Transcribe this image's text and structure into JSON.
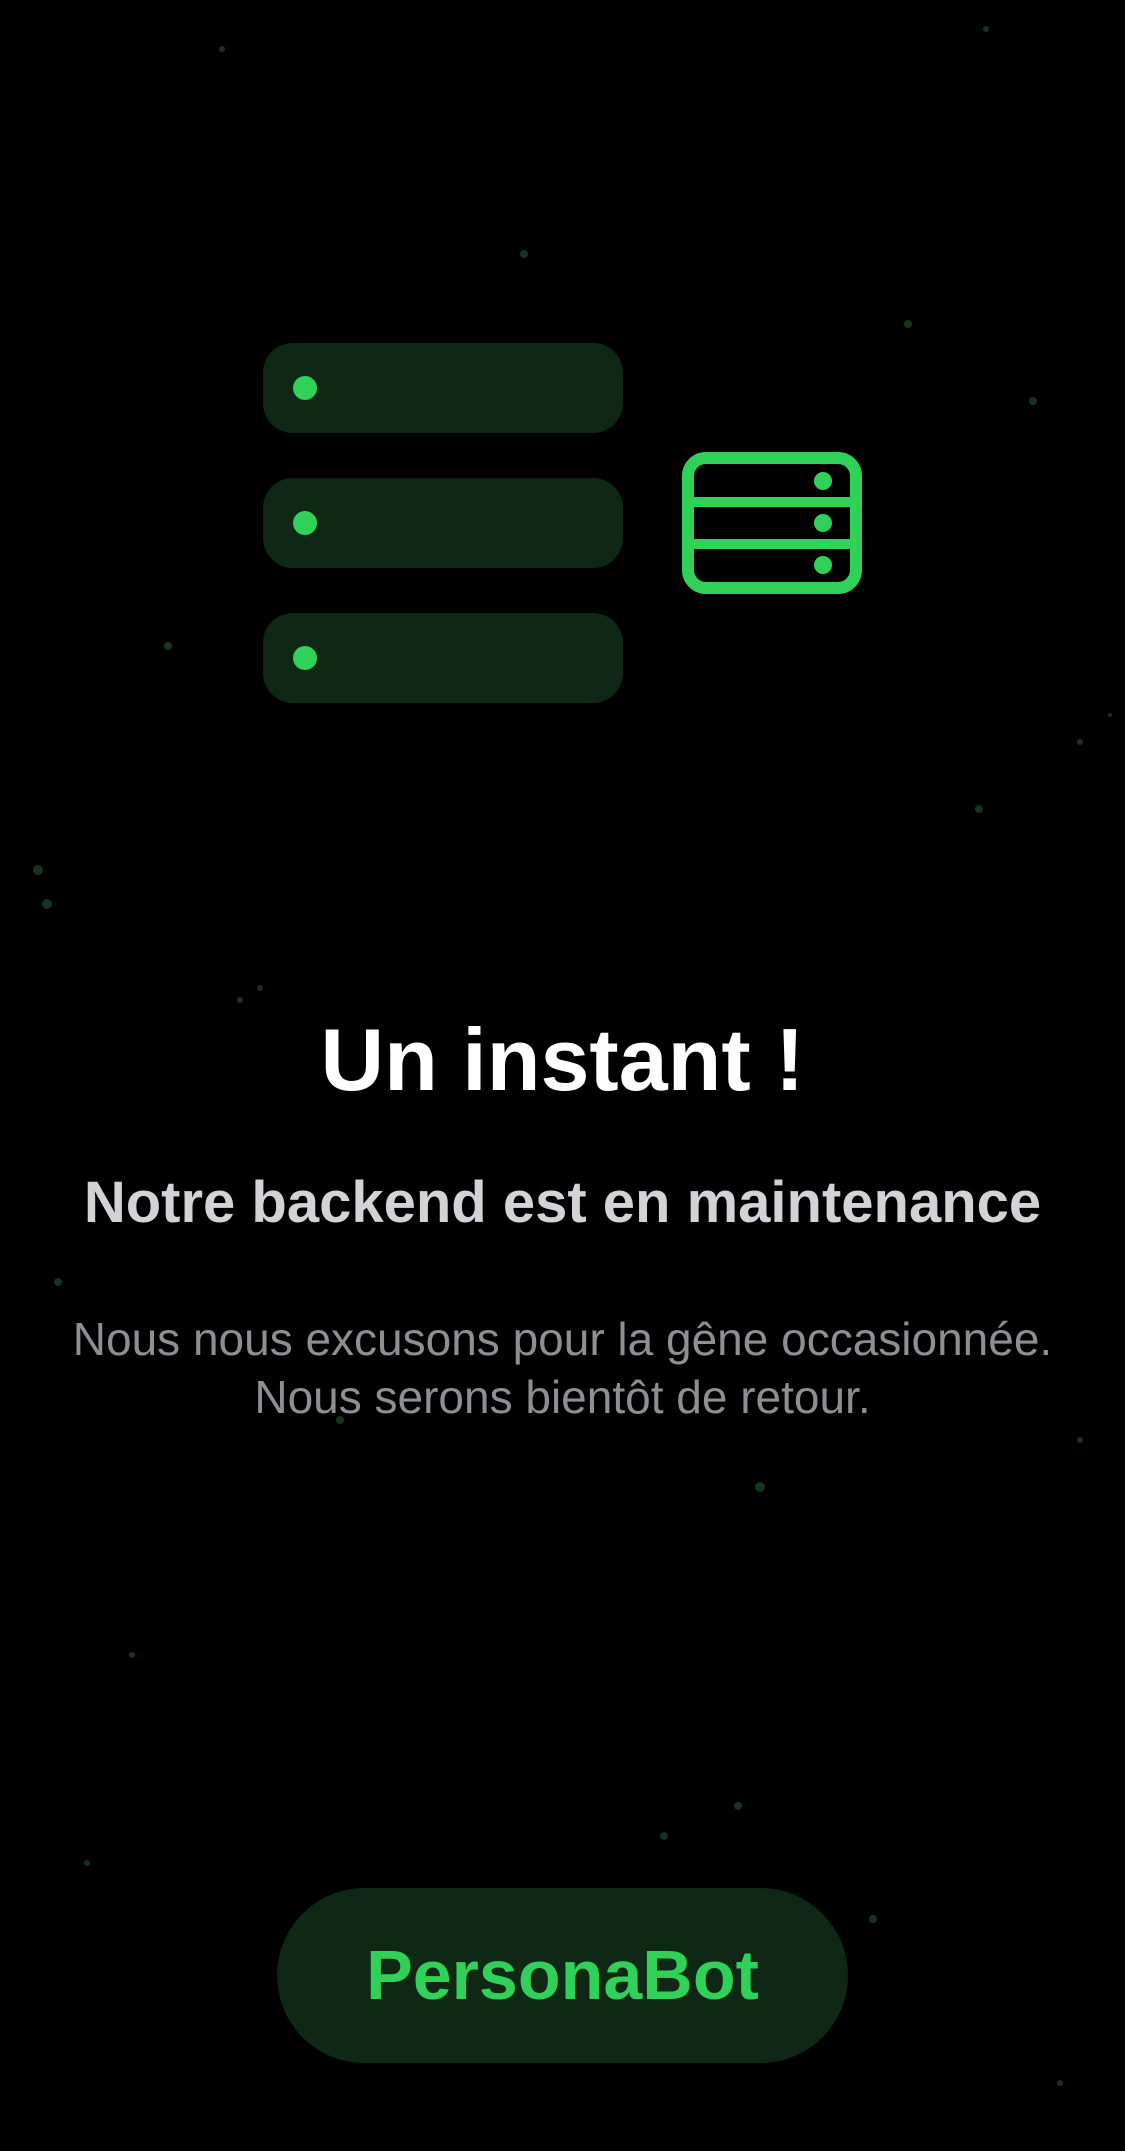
{
  "illustration": {
    "server_rows": 3,
    "accent_color": "#30d158",
    "row_color": "#0f2816",
    "icon": "server-rack-icon"
  },
  "content": {
    "title": "Un instant !",
    "subtitle": "Notre backend est en maintenance",
    "message_line1": "Nous nous excusons pour la gêne occasionnée.",
    "message_line2": "Nous serons bientôt de retour."
  },
  "brand": {
    "label": "PersonaBot"
  },
  "colors": {
    "background": "#000000",
    "accent": "#30d158",
    "title": "#ffffff",
    "subtitle": "#d2d2d7",
    "message": "#8e8e93"
  }
}
